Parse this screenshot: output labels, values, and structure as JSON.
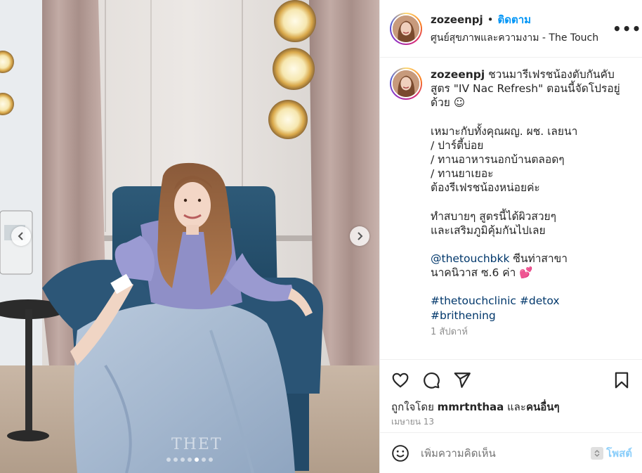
{
  "post": {
    "author": "zozeenpj",
    "separator": "•",
    "follow_label": "ติดตาม",
    "location": "ศูนย์สุขภาพและความงาม - The Touch",
    "more_label": "•••",
    "caption": {
      "line1": "ชวนมารีเฟรชน้องตับกันคับ สูตร \"IV Nac Refresh\" ตอนนี้จัดโปรอยู่ด้วย ☺",
      "para2": [
        "เหมาะกับทั้งคุณผญ. ผช. เลยนา",
        "/ ปาร์ตี้บ่อย",
        "/ ทานอาหารนอกบ้านตลอดๆ",
        "/ ทานยาเยอะ",
        "ต้องรีเฟรชน้องหน่อยค่ะ"
      ],
      "para3": [
        "ทำสบายๆ สูตรนี้ได้ผิวสวยๆ",
        "และเสริมภูมิคุ้มกันไปเลย"
      ],
      "mention": "@thetouchbkk",
      "mention_rest": " ซีนท่าสาขา",
      "mention_line2": "นาคนิวาส ซ.6 ค่า 💕",
      "tags": [
        "#thetouchclinic",
        "#detox",
        "#brithening"
      ]
    },
    "caption_time": "1 สัปดาห์",
    "likes_prefix": "ถูกใจโดย ",
    "likes_user": "mmrtnthaa",
    "likes_mid": " และ",
    "likes_others": "คนอื่นๆ",
    "date": "เมษายน 13",
    "comment_placeholder": "เพิ่มความคิดเห็น",
    "post_button": "โพสต์",
    "watermark": "THET",
    "carousel": {
      "count": 7,
      "active": 4
    }
  },
  "icons": {
    "like": "heart-icon",
    "comment": "comment-icon",
    "share": "send-icon",
    "save": "bookmark-icon",
    "emoji": "emoji-icon",
    "prev": "chevron-left-icon",
    "next": "chevron-right-icon"
  },
  "colors": {
    "accent": "#0095f6",
    "link": "#00376b",
    "muted": "#8e8e8e",
    "text": "#262626"
  }
}
